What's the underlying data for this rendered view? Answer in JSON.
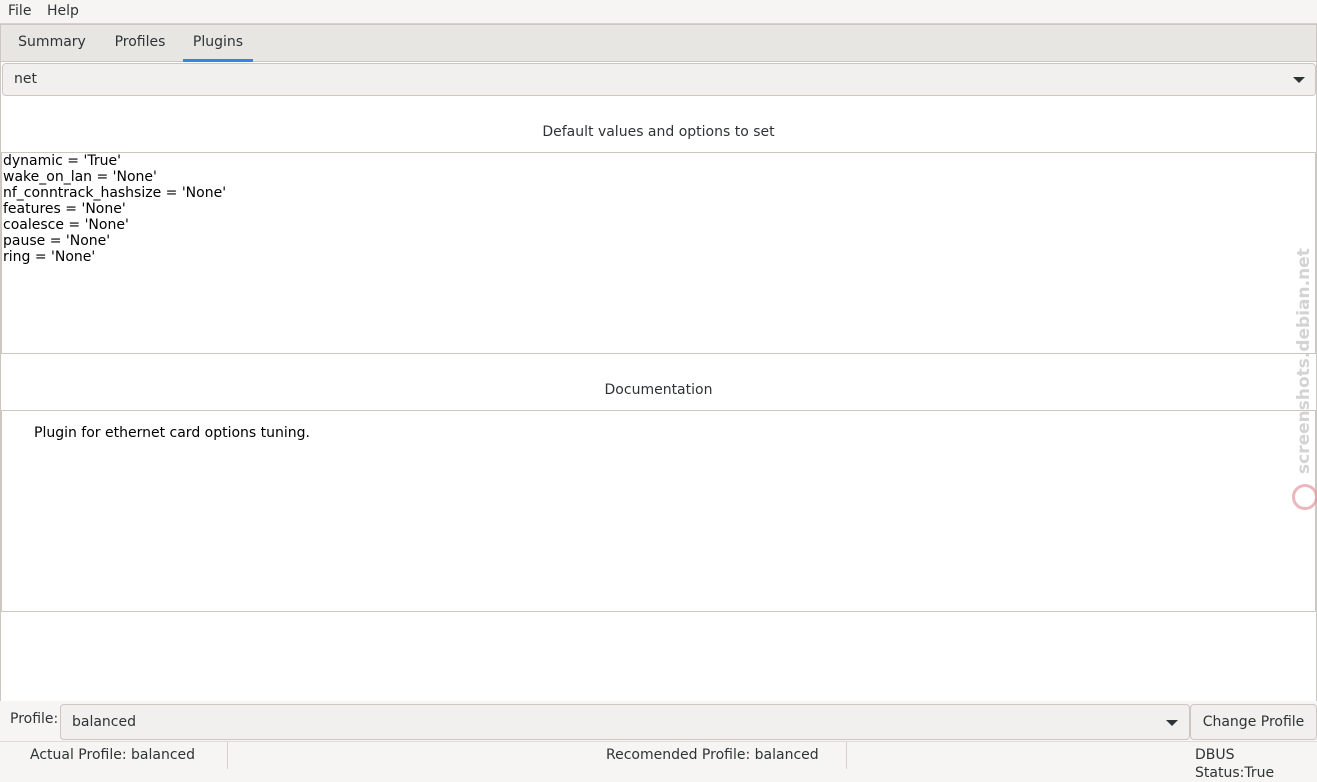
{
  "menu": {
    "file": "File",
    "help": "Help"
  },
  "tabs": [
    {
      "label": "Summary"
    },
    {
      "label": "Profiles"
    },
    {
      "label": "Plugins"
    }
  ],
  "plugin_select": {
    "value": "net"
  },
  "defaults_section": {
    "title": "Default values and options to set",
    "lines": [
      "dynamic = 'True'",
      "wake_on_lan = 'None'",
      "nf_conntrack_hashsize = 'None'",
      "features = 'None'",
      "coalesce = 'None'",
      "pause = 'None'",
      "ring = 'None'"
    ]
  },
  "documentation_section": {
    "title": "Documentation",
    "text": "Plugin for ethernet card options tuning."
  },
  "profile_row": {
    "label": "Profile:",
    "value": "balanced",
    "change_button": "Change Profile"
  },
  "statusbar": {
    "actual": "Actual Profile:  balanced",
    "recommended": "Recomended Profile:  balanced",
    "dbus": "DBUS Status:True"
  },
  "watermark": {
    "text": "screenshots.debian.net",
    "icon": "debian-swirl-icon"
  },
  "colors": {
    "accent": "#3584e4",
    "window_bg": "#f6f5f4",
    "border": "#cdc7c2"
  }
}
